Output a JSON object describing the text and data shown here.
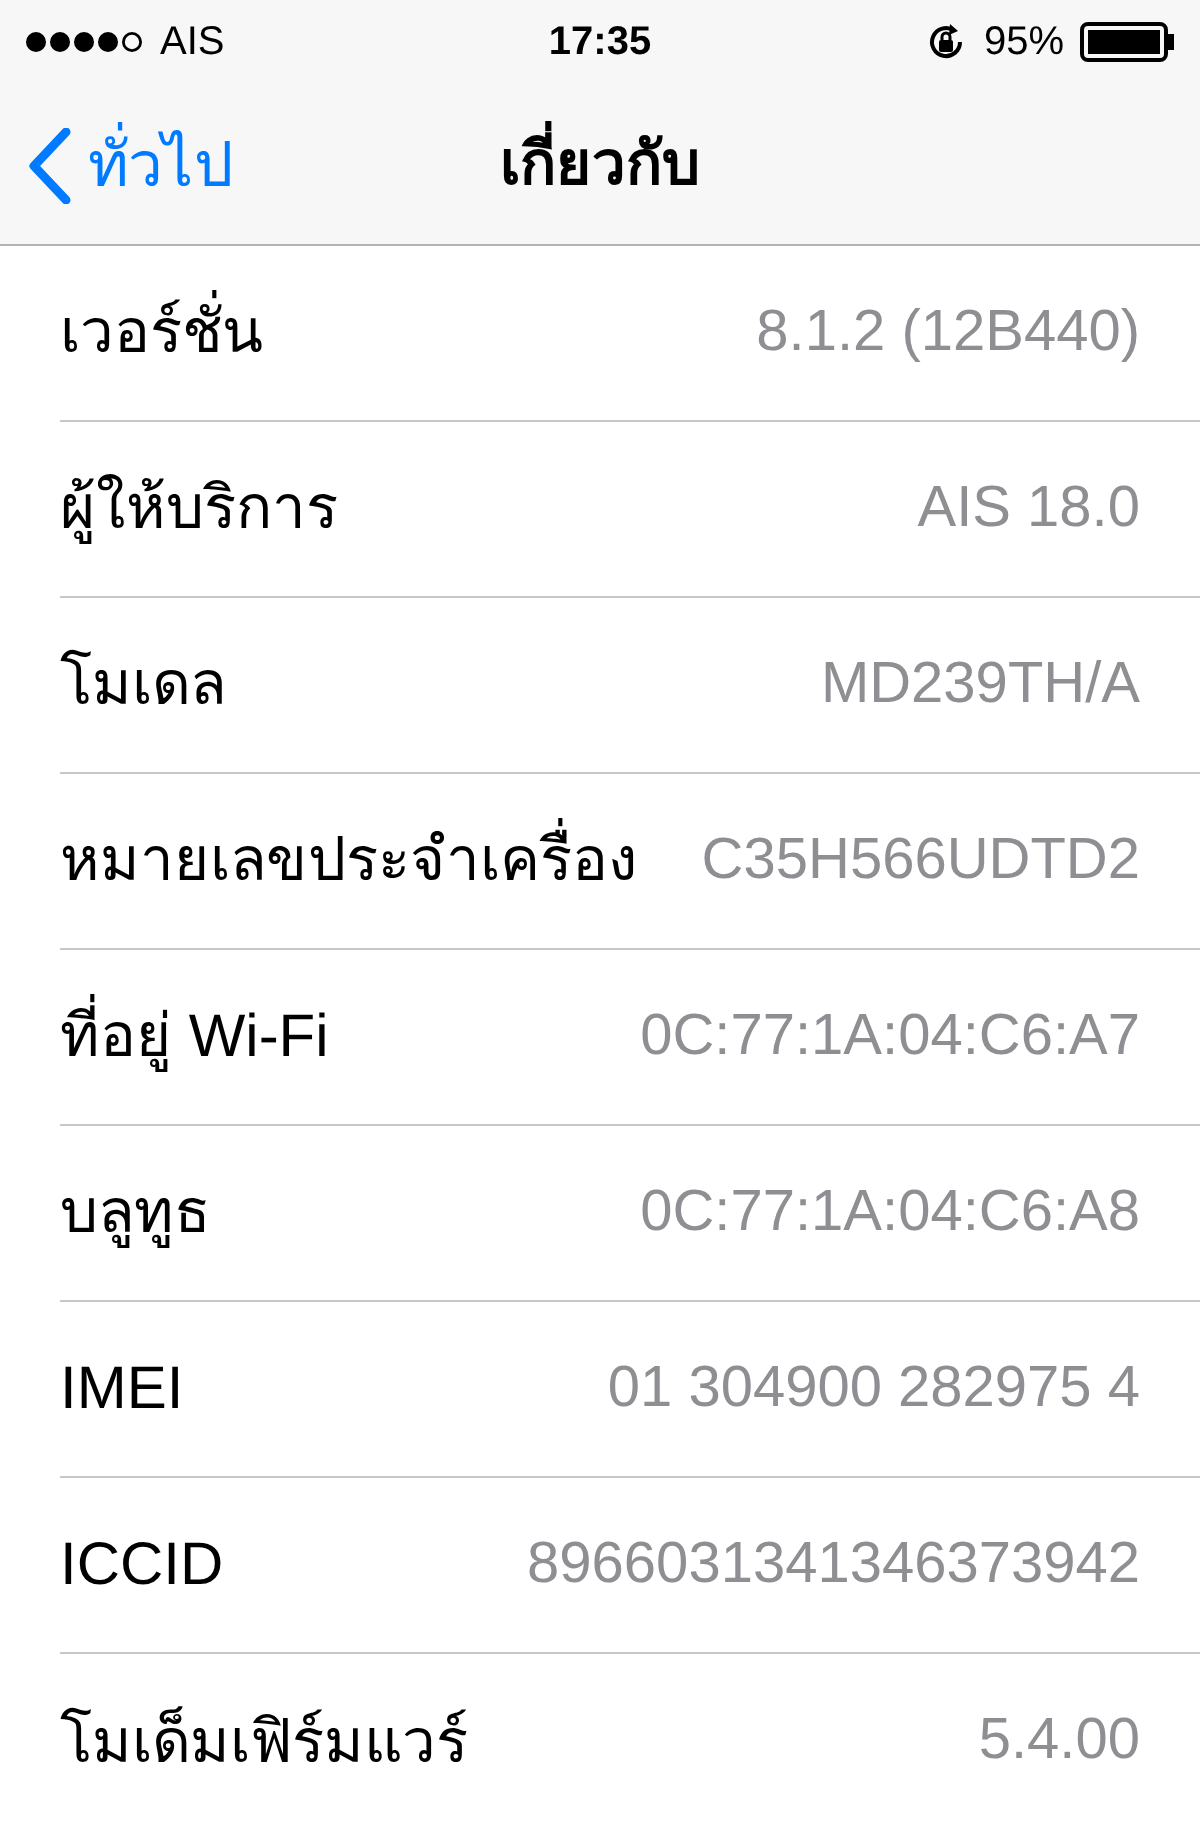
{
  "status_bar": {
    "carrier": "AIS",
    "time": "17:35",
    "battery_text": "95%"
  },
  "nav_bar": {
    "back_label": "ทั่วไป",
    "title": "เกี่ยวกับ"
  },
  "rows": [
    {
      "label": "เวอร์ชั่น",
      "value": "8.1.2 (12B440)"
    },
    {
      "label": "ผู้ให้บริการ",
      "value": "AIS 18.0"
    },
    {
      "label": "โมเดล",
      "value": "MD239TH/A"
    },
    {
      "label": "หมายเลขประจำเครื่อง",
      "value": "C35H566UDTD2"
    },
    {
      "label": "ที่อยู่ Wi-Fi",
      "value": "0C:77:1A:04:C6:A7"
    },
    {
      "label": "บลูทูธ",
      "value": "0C:77:1A:04:C6:A8"
    },
    {
      "label": "IMEI",
      "value": "01 304900 282975 4"
    },
    {
      "label": "ICCID",
      "value": "8966031341346373942"
    },
    {
      "label": "โมเด็มเฟิร์มแวร์",
      "value": "5.4.00"
    }
  ]
}
